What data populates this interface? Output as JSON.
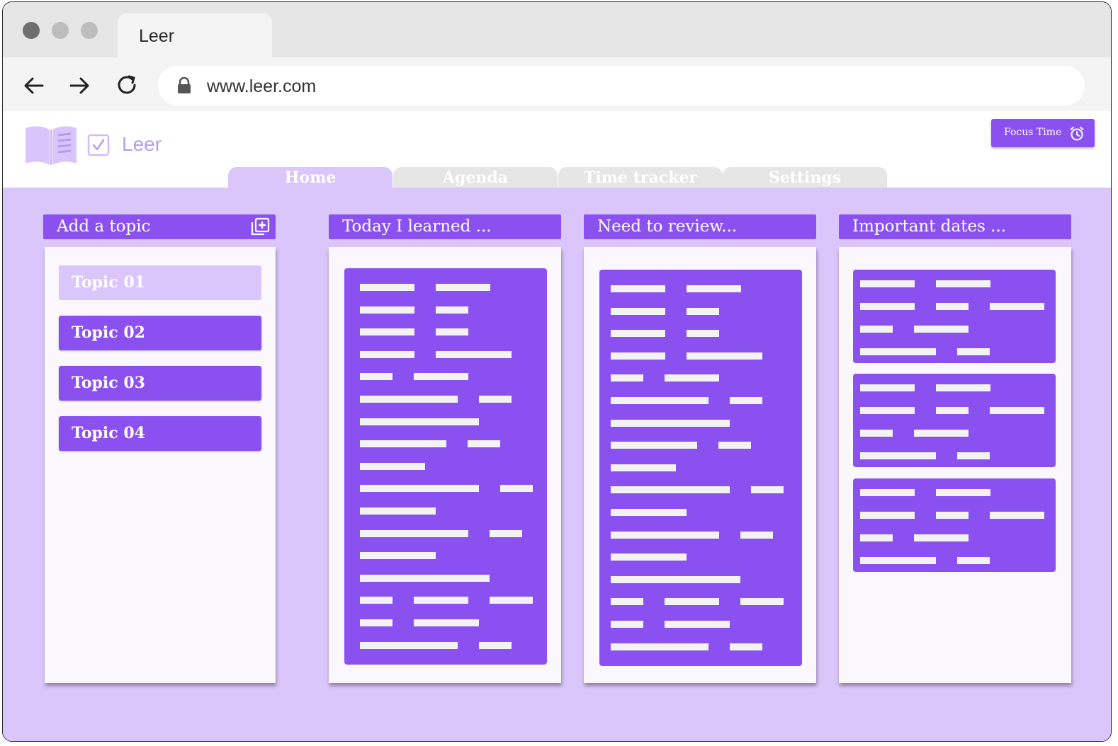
{
  "browser": {
    "tab_title": "Leer",
    "url": "www.leer.com"
  },
  "app": {
    "name": "Leer",
    "focus_button": "Focus Time",
    "tabs": [
      "Home",
      "Agenda",
      "Time tracker",
      "Settings"
    ],
    "active_tab": "Home"
  },
  "columns": {
    "topics": {
      "header": "Add a topic",
      "items": [
        "Topic 01",
        "Topic 02",
        "Topic 03",
        "Topic 04"
      ],
      "selected": "Topic 01"
    },
    "learned": {
      "header": "Today I learned ..."
    },
    "review": {
      "header": "Need to review..."
    },
    "dates": {
      "header": "Important dates ..."
    }
  },
  "colors": {
    "accent": "#8b51f0",
    "accent_light": "#dbc6fb",
    "panel": "#faf7fd"
  }
}
